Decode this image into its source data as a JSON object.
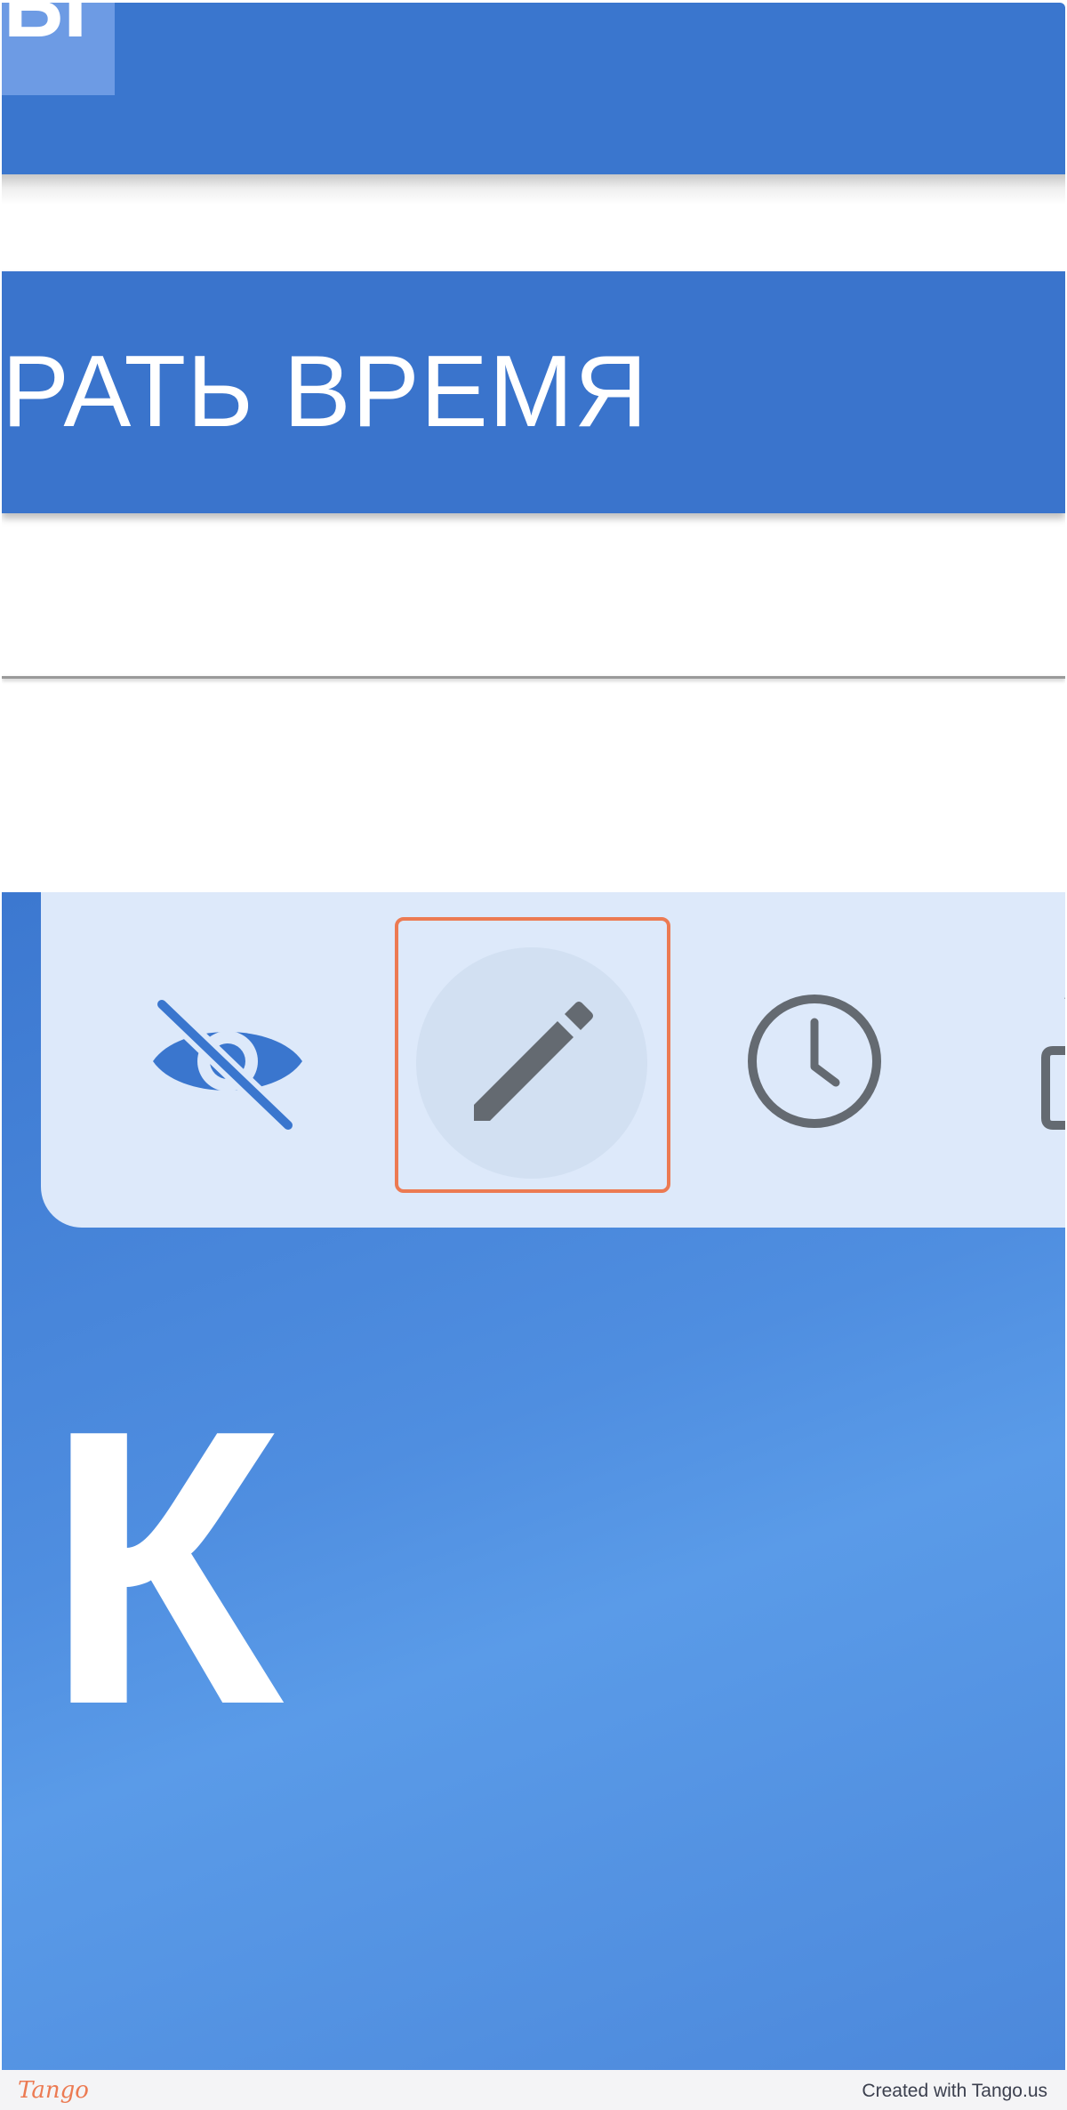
{
  "header": {
    "logo_text": "Ы"
  },
  "time_button": {
    "label": "РАТЬ ВРЕМЯ"
  },
  "toolbar": {
    "hide_icon": "eye-off-icon",
    "edit_icon": "pencil-icon",
    "clock_icon": "clock-icon",
    "more_icon": "share-icon"
  },
  "card": {
    "letter": "К"
  },
  "footer": {
    "brand": "Tango",
    "credit": "Created with Tango.us"
  },
  "colors": {
    "primary_blue": "#3a76ce",
    "toolbar_bg": "#dde9fa",
    "icon_gray": "#646a71",
    "icon_blue": "#3a76ce",
    "highlight": "#ec7a52"
  }
}
